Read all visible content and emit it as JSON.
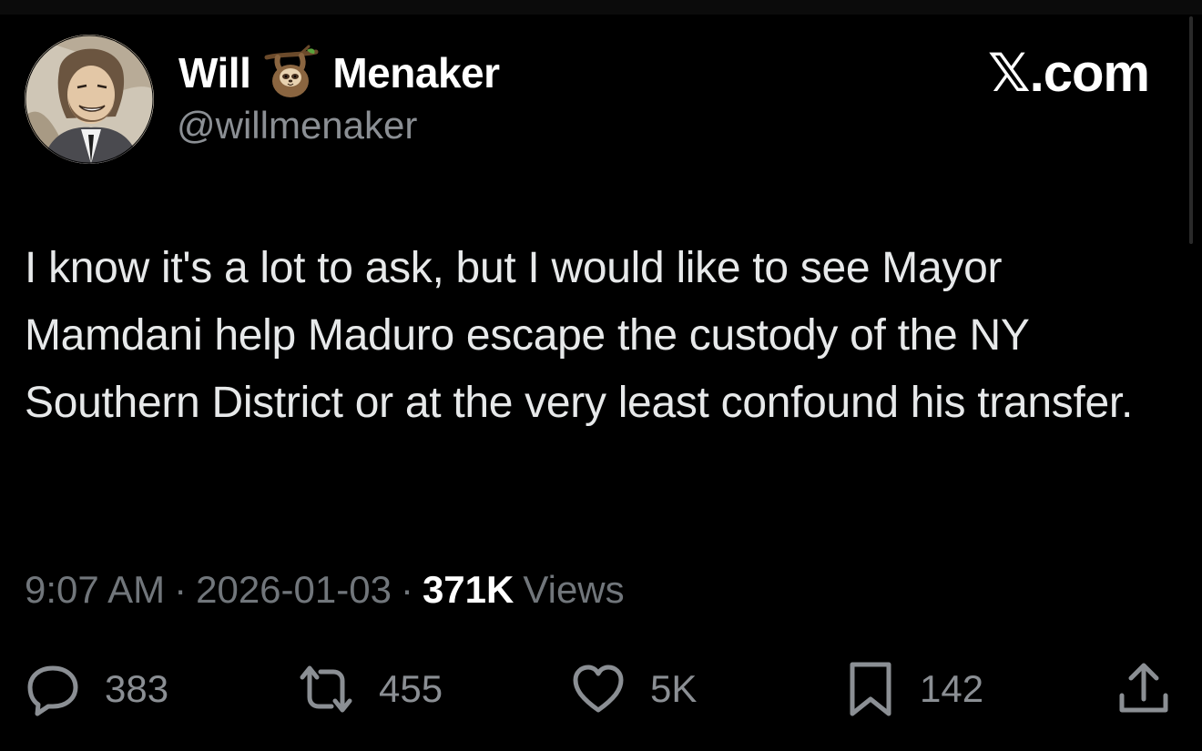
{
  "author": {
    "name_first": "Will",
    "name_last": "Menaker",
    "handle": "@willmenaker",
    "name_emoji": "sloth-emoji"
  },
  "brand": "𝕏.com",
  "tweet": {
    "text": "I know it's a lot to ask, but I would like to see Mayor Mamdani help Maduro escape the custody of the NY Southern District or at the very least confound his transfer."
  },
  "meta": {
    "time": "9:07 AM",
    "separator": "·",
    "date": "2026-01-03",
    "views_count": "371K",
    "views_label": "Views"
  },
  "actions": {
    "replies": {
      "icon": "reply-icon",
      "count": "383"
    },
    "reposts": {
      "icon": "repost-icon",
      "count": "455"
    },
    "likes": {
      "icon": "heart-icon",
      "count": "5K"
    },
    "bookmarks": {
      "icon": "bookmark-icon",
      "count": "142"
    },
    "share": {
      "icon": "share-icon"
    }
  },
  "colors": {
    "background": "#000000",
    "primary_text": "#e7e9ea",
    "secondary_text": "#71767b",
    "icon": "#8b8f94"
  }
}
